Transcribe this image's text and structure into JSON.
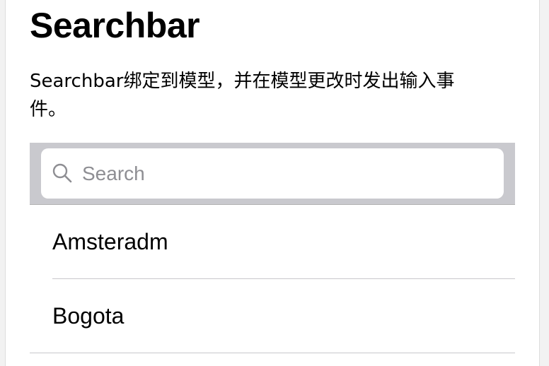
{
  "page": {
    "title": "Searchbar",
    "description": "Searchbar绑定到模型，并在模型更改时发出输入事件。"
  },
  "searchbar": {
    "placeholder": "Search",
    "value": "",
    "icon": "search-icon",
    "background_color": "#c9c9ce"
  },
  "list": {
    "items": [
      {
        "label": "Amsteradm"
      },
      {
        "label": "Bogota"
      }
    ]
  }
}
